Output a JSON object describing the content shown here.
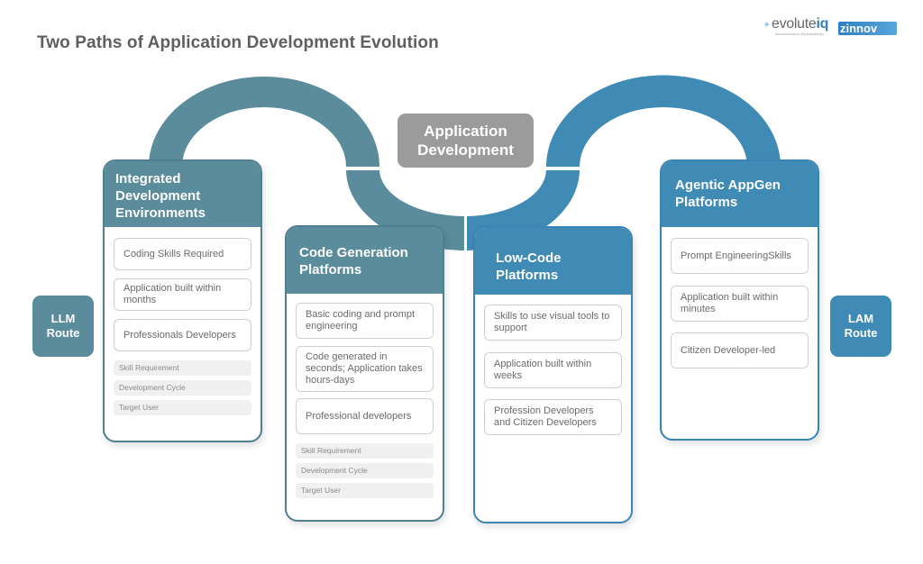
{
  "title": "Two Paths of Application Development Evolution",
  "logos": {
    "evolute": {
      "name_plain": "evolute",
      "name_accent": "iq",
      "tagline": "Autonomous Automation",
      "icon": "sparkle-icon"
    },
    "zinnov": {
      "name": "zinnov"
    }
  },
  "colors": {
    "llm_path": "#5b8c9c",
    "lam_path": "#3f8bb5",
    "center": "#9b9b9b",
    "title": "#5f5f5f"
  },
  "center": {
    "label_line1": "Application",
    "label_line2": "Development"
  },
  "routes": {
    "llm": {
      "line1": "LLM",
      "line2": "Route"
    },
    "lam": {
      "line1": "LAM",
      "line2": "Route"
    }
  },
  "cards": [
    {
      "title": "Integrated Development Environments",
      "items": [
        "Coding Skills Required",
        "Application built within months",
        "Professionals Developers"
      ],
      "labels": [
        "Skill Requirement",
        "Development Cycle",
        "Target User"
      ]
    },
    {
      "title": "Code Generation Platforms",
      "items": [
        "Basic coding and prompt engineering",
        "Code generated in seconds; Application takes hours-days",
        "Professional developers"
      ],
      "labels": [
        "Skill Requirement",
        "Development Cycle",
        "Target User"
      ]
    },
    {
      "title": "Low-Code Platforms",
      "items": [
        "Skills to use visual tools to support",
        "Application built within weeks",
        "Profession Developers and Citizen Developers"
      ]
    },
    {
      "title": "Agentic AppGen Platforms",
      "items": [
        "Prompt EngineeringSkills",
        "Application built within minutes",
        "Citizen Developer-led"
      ]
    }
  ]
}
